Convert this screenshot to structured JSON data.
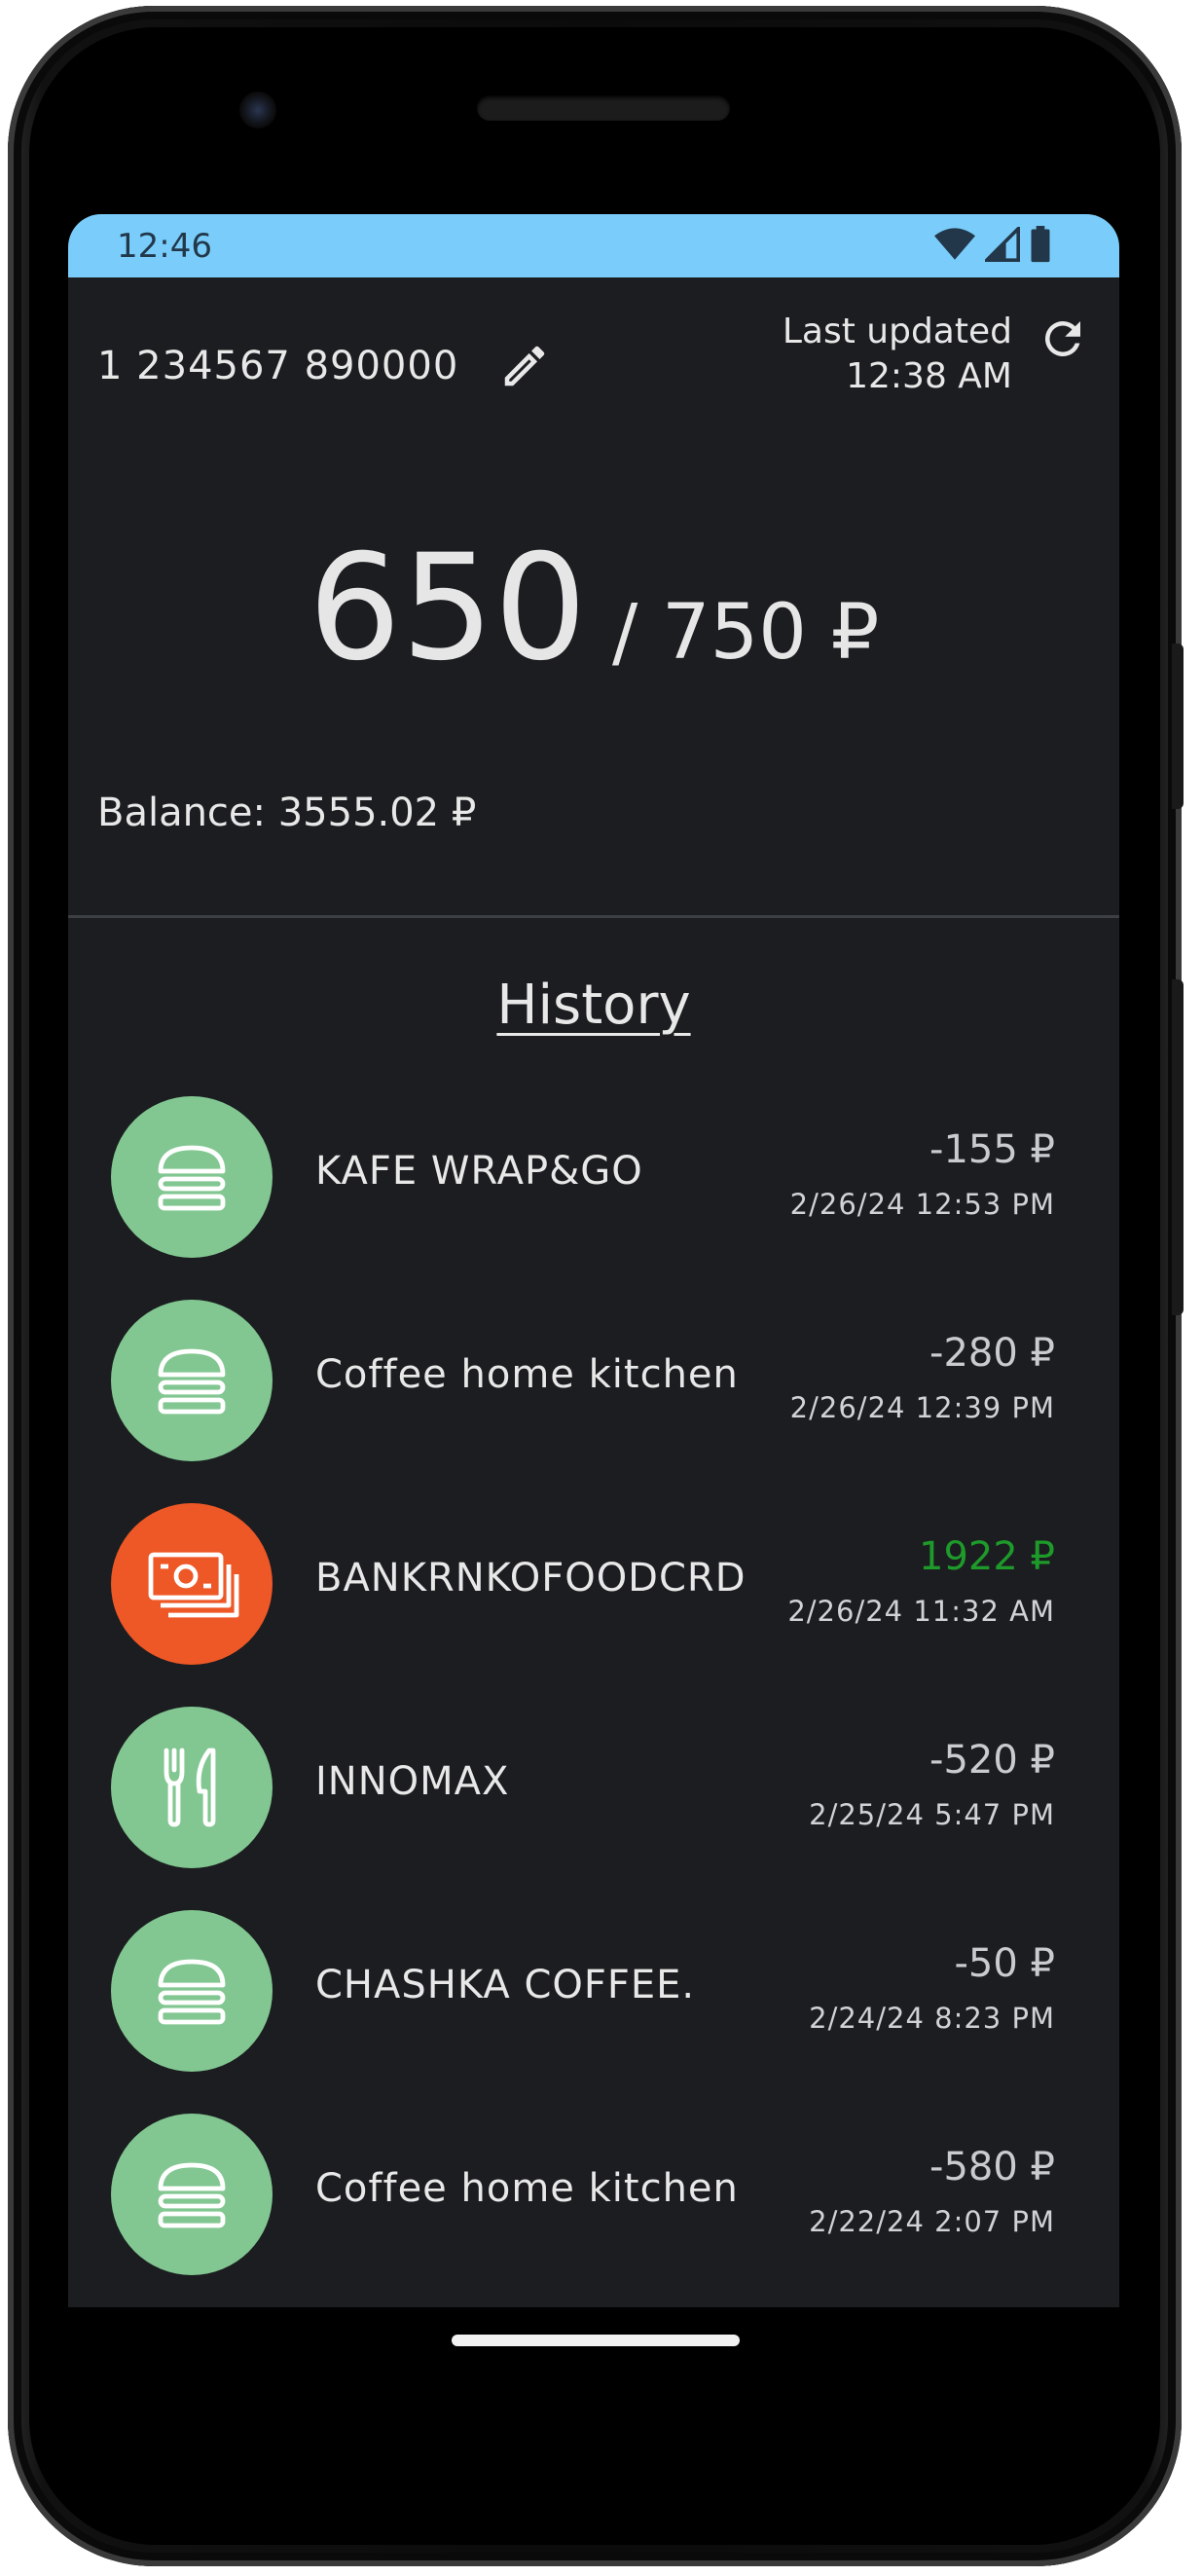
{
  "status_bar": {
    "time": "12:46",
    "color": "#7acdfb",
    "icons": [
      "wifi-icon",
      "signal-icon",
      "battery-icon"
    ]
  },
  "card": {
    "number": "1 234567 890000",
    "edit_icon": "pencil-icon"
  },
  "update": {
    "label": "Last updated",
    "time": "12:38 AM",
    "refresh_icon": "refresh-icon"
  },
  "limit": {
    "spent": "650",
    "total": "/ 750 ₽"
  },
  "balance": {
    "text": "Balance: 3555.02 ₽"
  },
  "history": {
    "title": "History",
    "items": [
      {
        "name": "KAFE WRAP&GO",
        "amount": "-155 ₽",
        "date": "2/26/24 12:53 PM",
        "icon": "burger-icon",
        "icon_color": "#82c791",
        "type": "expense"
      },
      {
        "name": "Coffee home kitchen",
        "amount": "-280 ₽",
        "date": "2/26/24 12:39 PM",
        "icon": "burger-icon",
        "icon_color": "#82c791",
        "type": "expense"
      },
      {
        "name": "BANKRNKOFOODCRD",
        "amount": "1922 ₽",
        "date": "2/26/24 11:32 AM",
        "icon": "cash-icon",
        "icon_color": "#ee5726",
        "type": "income"
      },
      {
        "name": "INNOMAX",
        "amount": "-520 ₽",
        "date": "2/25/24 5:47 PM",
        "icon": "cutlery-icon",
        "icon_color": "#82c791",
        "type": "expense"
      },
      {
        "name": "CHASHKA COFFEE.",
        "amount": "-50 ₽",
        "date": "2/24/24 8:23 PM",
        "icon": "burger-icon",
        "icon_color": "#82c791",
        "type": "expense"
      },
      {
        "name": "Coffee home kitchen",
        "amount": "-580 ₽",
        "date": "2/22/24 2:07 PM",
        "icon": "burger-icon",
        "icon_color": "#82c791",
        "type": "expense"
      }
    ]
  },
  "colors": {
    "background": "#1b1d20",
    "income": "#1e9a2a",
    "expense_text": "#c9cbcf"
  }
}
